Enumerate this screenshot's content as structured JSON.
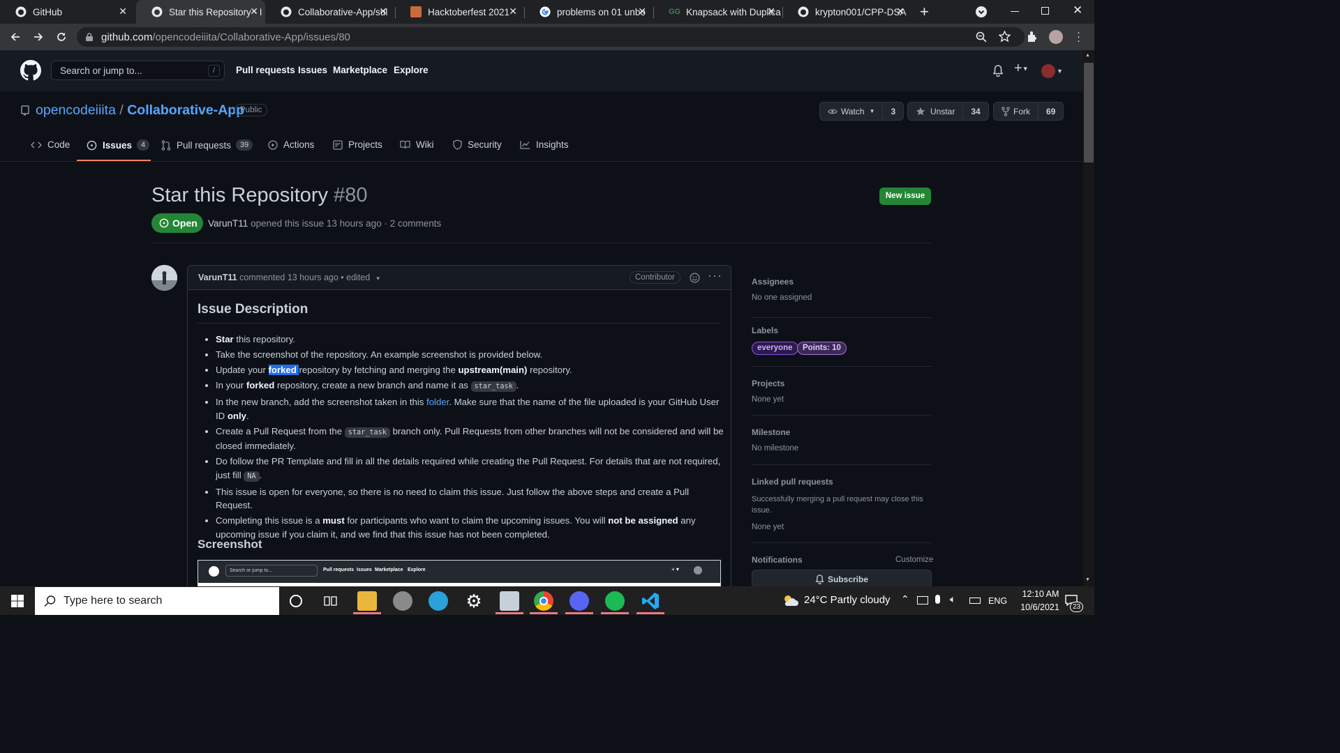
{
  "browser": {
    "tabs": [
      {
        "title": "GitHub",
        "active": false
      },
      {
        "title": "Star this Repository · I",
        "active": true
      },
      {
        "title": "Collaborative-App/sul",
        "active": false
      },
      {
        "title": "Hacktoberfest 2021",
        "active": false
      },
      {
        "title": "problems on 01 unbo",
        "active": false
      },
      {
        "title": "Knapsack with Duplica",
        "active": false
      },
      {
        "title": "krypton001/CPP-DSA",
        "active": false
      }
    ],
    "url_domain": "github.com",
    "url_path": "/opencodeiiita/Collaborative-App/issues/80",
    "close_glyph": "✕",
    "new_tab_glyph": "+"
  },
  "github_header": {
    "search_placeholder": "Search or jump to...",
    "search_shortcut": "/",
    "nav": [
      "Pull requests",
      "Issues",
      "Marketplace",
      "Explore"
    ],
    "plus_glyph": "+"
  },
  "repo": {
    "owner": "opencodeiiita",
    "separator": "/",
    "name": "Collaborative-App",
    "visibility": "Public",
    "watch_label": "Watch",
    "watch_count": "3",
    "star_label": "Unstar",
    "star_count": "34",
    "fork_label": "Fork",
    "fork_count": "69",
    "tabs": [
      {
        "label": "Code",
        "count": "",
        "icon": "code-icon"
      },
      {
        "label": "Issues",
        "count": "4",
        "icon": "issue-icon"
      },
      {
        "label": "Pull requests",
        "count": "39",
        "icon": "pull-request-icon"
      },
      {
        "label": "Actions",
        "count": "",
        "icon": "play-icon"
      },
      {
        "label": "Projects",
        "count": "",
        "icon": "project-icon"
      },
      {
        "label": "Wiki",
        "count": "",
        "icon": "book-icon"
      },
      {
        "label": "Security",
        "count": "",
        "icon": "shield-icon"
      },
      {
        "label": "Insights",
        "count": "",
        "icon": "graph-icon"
      }
    ]
  },
  "issue": {
    "title": "Star this Repository",
    "number": "#80",
    "new_issue_label": "New issue",
    "state": "Open",
    "author": "VarunT11",
    "meta_rest": "opened this issue 13 hours ago · 2 comments",
    "comment": {
      "author": "VarunT11",
      "meta": "commented 13 hours ago • edited",
      "role": "Contributor",
      "heading": "Issue Description",
      "items": {
        "i1_b": "Star",
        "i1_t": " this repository.",
        "i2": "Take the screenshot of the repository. An example screenshot is provided below.",
        "i3_a": "Update your ",
        "i3_hl": "forked ",
        "i3_b": "repository by fetching and merging the ",
        "i3_bold": "upstream(main)",
        "i3_c": " repository.",
        "i4_a": "In your ",
        "i4_bold": "forked",
        "i4_b": " repository, create a new branch and name it as ",
        "i4_code": "star_task",
        "i4_c": ".",
        "i5_a": "In the new branch, add the screenshot taken in this ",
        "i5_link": "folder",
        "i5_b": ". Make sure that the name of the file uploaded is your GitHub User ID ",
        "i5_bold": "only",
        "i5_c": ".",
        "i6_a": "Create a Pull Request from the ",
        "i6_code": "star_task",
        "i6_b": " branch only. Pull Requests from other branches will not be considered and will be closed immediately.",
        "i7_a": "Do follow the PR Template and fill in all the details required while creating the Pull Request. For details that are not required, just fill ",
        "i7_code": "NA",
        "i7_b": ".",
        "i8": "This issue is open for everyone, so there is no need to claim this issue. Just follow the above steps and create a Pull Request.",
        "i9_a": "Completing this issue is a ",
        "i9_bold": "must",
        "i9_b": " for participants who want to claim the upcoming issues. You will ",
        "i9_bold2": "not be assigned",
        "i9_c": " any upcoming issue if you claim it, and we find that this issue has not been completed."
      },
      "screenshot_heading": "Screenshot",
      "screenshot": {
        "search": "Search or jump to...",
        "nav": [
          "Pull requests",
          "Issues",
          "Marketplace",
          "Explore"
        ],
        "icons": "+ ▾"
      }
    }
  },
  "sidebar": {
    "assignees_title": "Assignees",
    "assignees_value": "No one assigned",
    "labels_title": "Labels",
    "labels": [
      {
        "name": "everyone",
        "color": "#8957e5"
      },
      {
        "name": "Points: 10",
        "color": "#d2a8ff"
      }
    ],
    "projects_title": "Projects",
    "projects_value": "None yet",
    "milestone_title": "Milestone",
    "milestone_value": "No milestone",
    "linked_title": "Linked pull requests",
    "linked_desc": "Successfully merging a pull request may close this issue.",
    "linked_value": "None yet",
    "notifications_title": "Notifications",
    "customize": "Customize",
    "subscribe": "Subscribe"
  },
  "taskbar": {
    "search_placeholder": "Type here to search",
    "weather": "24°C  Partly cloudy",
    "lang": "ENG",
    "time": "12:10 AM",
    "date": "10/6/2021",
    "notif_count": "23"
  },
  "colors": {
    "bg": "#0d1117",
    "header": "#161b22",
    "accent_green": "#238636",
    "link_blue": "#58a6ff",
    "tab_underline": "#f78166"
  }
}
